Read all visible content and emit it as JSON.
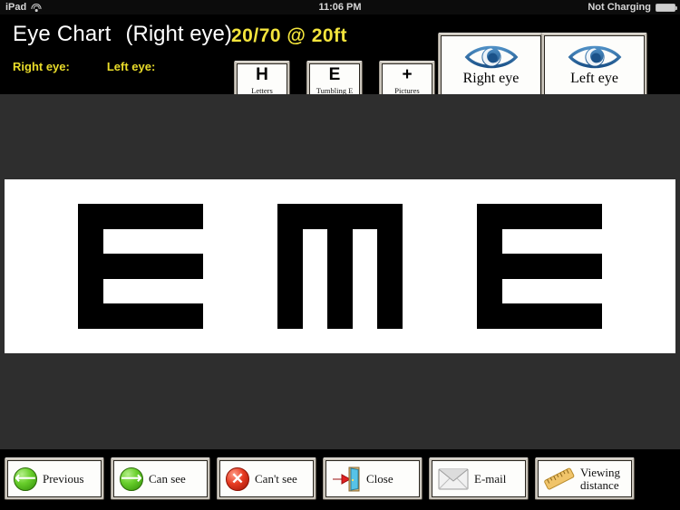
{
  "status_bar": {
    "device": "iPad",
    "wifi_icon": "wifi-icon",
    "time": "11:06 PM",
    "battery_text": "Not Charging",
    "battery_icon": "battery-icon"
  },
  "header": {
    "app_title": "Eye Chart",
    "current_eye": "(Right eye)",
    "acuity": "20/70 @ 20ft",
    "acuity_color": "#f3e43c",
    "scores": [
      {
        "label": "Right eye:",
        "value": ""
      },
      {
        "label": "Left eye:",
        "value": ""
      }
    ],
    "mode_buttons": [
      {
        "glyph": "H",
        "caption": "Letters",
        "icon": "letter-h-icon"
      },
      {
        "glyph": "E",
        "caption": "Tumbling E",
        "icon": "letter-e-icon"
      },
      {
        "glyph": "+",
        "caption": "Pictures",
        "icon": "plus-icon"
      }
    ],
    "eye_buttons": [
      {
        "caption": "Right eye",
        "icon": "eye-icon",
        "color": "#2a6aa8"
      },
      {
        "caption": "Left eye",
        "icon": "eye-icon",
        "color": "#2a6aa8"
      }
    ]
  },
  "chart": {
    "background": "#2e2e2e",
    "panel_background": "#ffffff",
    "optotype_color": "#000000",
    "mode": "Tumbling E",
    "optotypes": [
      {
        "letter": "E",
        "rotation": 0,
        "direction": "right",
        "size": 138
      },
      {
        "letter": "E",
        "rotation": 90,
        "direction": "up",
        "size": 138
      },
      {
        "letter": "E",
        "rotation": 0,
        "direction": "right",
        "size": 138
      }
    ]
  },
  "footer": {
    "buttons": [
      {
        "label": "Previous",
        "icon": "arrow-left-circle-icon"
      },
      {
        "label": "Can see",
        "icon": "arrow-right-circle-icon"
      },
      {
        "label": "Can't see",
        "icon": "x-circle-icon"
      },
      {
        "label": "Close",
        "icon": "exit-door-icon"
      },
      {
        "label": "E-mail",
        "icon": "envelope-icon"
      },
      {
        "label": "Viewing\ndistance",
        "icon": "ruler-icon"
      }
    ]
  }
}
